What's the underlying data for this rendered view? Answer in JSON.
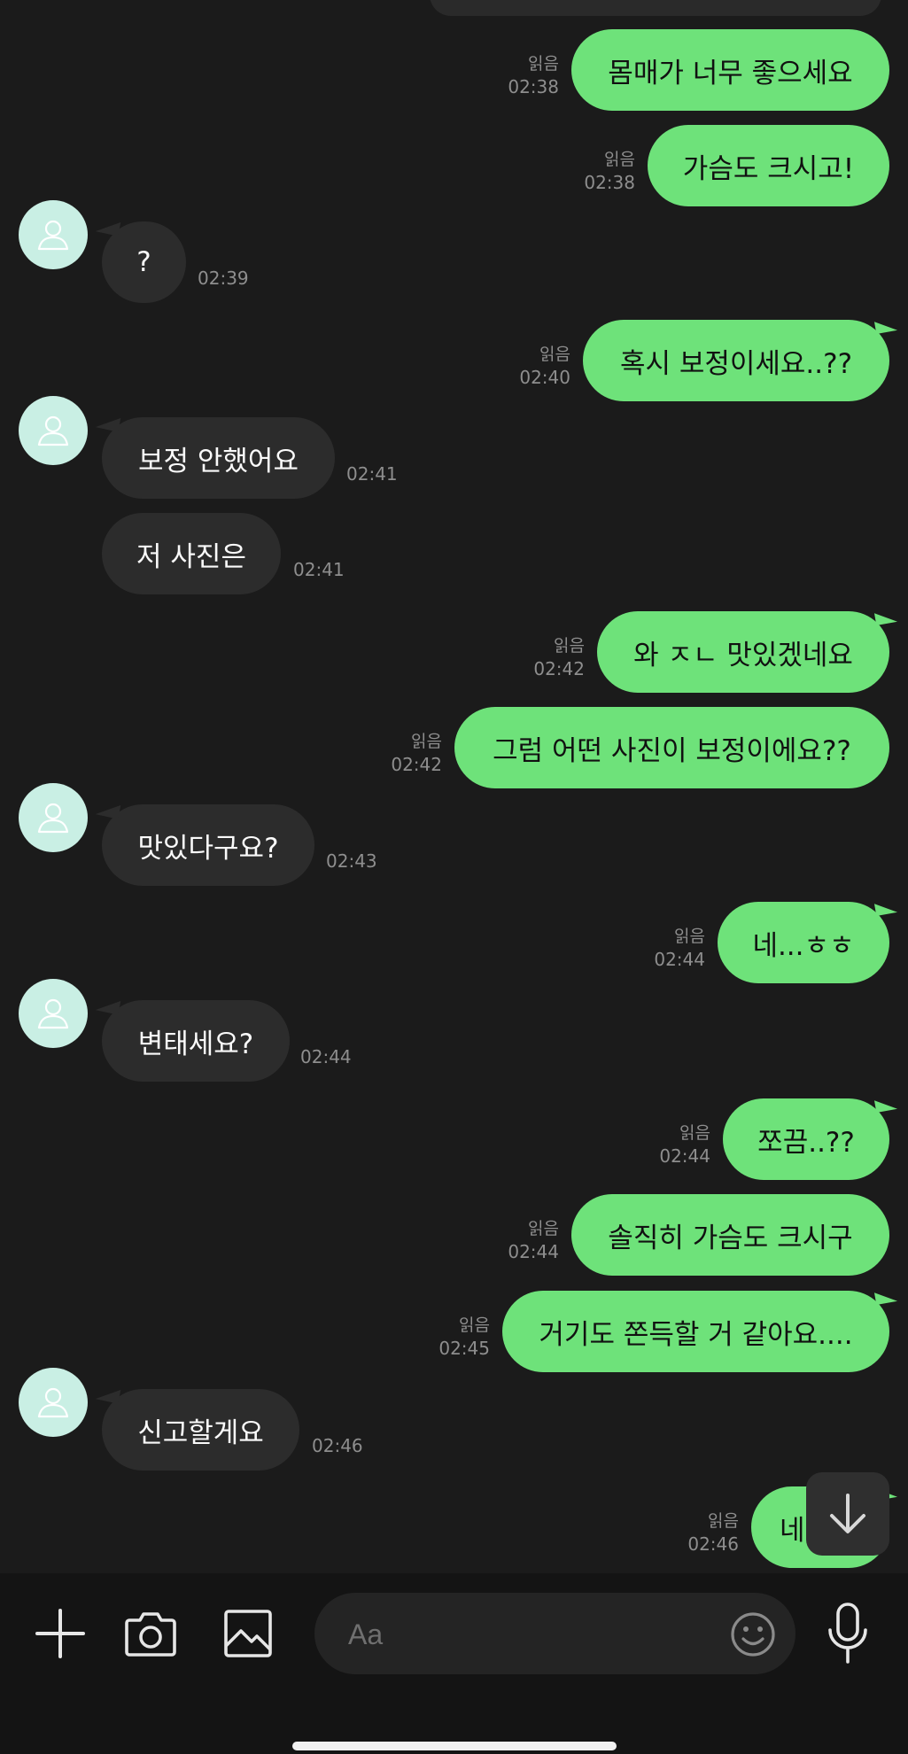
{
  "messages": [
    {
      "dir": "out",
      "text": "몸매가 너무 좋으세요",
      "read": "읽음",
      "time": "02:38"
    },
    {
      "dir": "out",
      "text": "가슴도 크시고!",
      "read": "읽음",
      "time": "02:38"
    },
    {
      "dir": "in",
      "text": "?",
      "time": "02:39"
    },
    {
      "dir": "out",
      "text": "혹시 보정이세요..??",
      "read": "읽음",
      "time": "02:40"
    },
    {
      "dir": "in",
      "text": "보정 안했어요",
      "time": "02:41"
    },
    {
      "dir": "in",
      "text": "저 사진은",
      "time": "02:41"
    },
    {
      "dir": "out",
      "text": "와 ㅈㄴ 맛있겠네요",
      "read": "읽음",
      "time": "02:42"
    },
    {
      "dir": "out",
      "text": "그럼 어떤 사진이 보정이에요??",
      "read": "읽음",
      "time": "02:42"
    },
    {
      "dir": "in",
      "text": "맛있다구요?",
      "time": "02:43"
    },
    {
      "dir": "out",
      "text": "네...ㅎㅎ",
      "read": "읽음",
      "time": "02:44"
    },
    {
      "dir": "in",
      "text": "변태세요?",
      "time": "02:44"
    },
    {
      "dir": "out",
      "text": "쪼끔..??",
      "read": "읽음",
      "time": "02:44"
    },
    {
      "dir": "out",
      "text": "솔직히 가슴도 크시구",
      "read": "읽음",
      "time": "02:44"
    },
    {
      "dir": "out",
      "text": "거기도 쫀득할 거 같아요....",
      "read": "읽음",
      "time": "02:45"
    },
    {
      "dir": "in",
      "text": "신고할게요",
      "time": "02:46"
    },
    {
      "dir": "out",
      "text": "네",
      "read": "읽음",
      "time": "02:46"
    }
  ],
  "composer": {
    "placeholder": "Aa",
    "icons": [
      "plus-icon",
      "camera-icon",
      "image-icon",
      "emoji-icon",
      "microphone-icon"
    ]
  },
  "colors": {
    "background": "#1b1b1b",
    "outgoing_bubble": "#6ee27a",
    "incoming_bubble": "#2c2c2c",
    "meta_text": "#8e8e8e",
    "avatar": "#c9efe4"
  }
}
